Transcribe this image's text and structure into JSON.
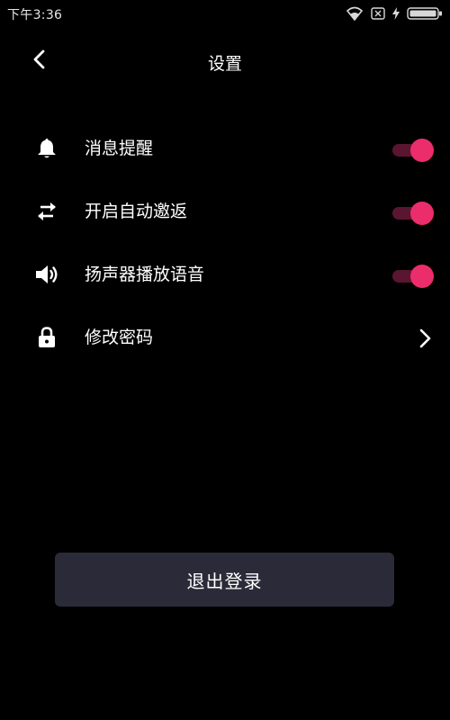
{
  "status_bar": {
    "time": "下午3:36",
    "icons": [
      "wifi-icon",
      "sim-icon",
      "charging-icon",
      "battery-icon"
    ]
  },
  "header": {
    "title": "设置",
    "back_icon": "chevron-left-icon"
  },
  "settings": [
    {
      "label": "消息提醒",
      "icon": "bell-icon",
      "control": "toggle",
      "enabled": true
    },
    {
      "label": "开启自动邀返",
      "icon": "swap-arrows-icon",
      "control": "toggle",
      "enabled": true
    },
    {
      "label": "扬声器播放语音",
      "icon": "speaker-icon",
      "control": "toggle",
      "enabled": true
    },
    {
      "label": "修改密码",
      "icon": "lock-icon",
      "control": "chevron"
    }
  ],
  "logout": {
    "label": "退出登录"
  },
  "colors": {
    "background": "#000000",
    "accent": "#ec2d6b",
    "toggle_track": "#5a1530",
    "button_bg": "#2b2a38",
    "text": "#ffffff"
  }
}
